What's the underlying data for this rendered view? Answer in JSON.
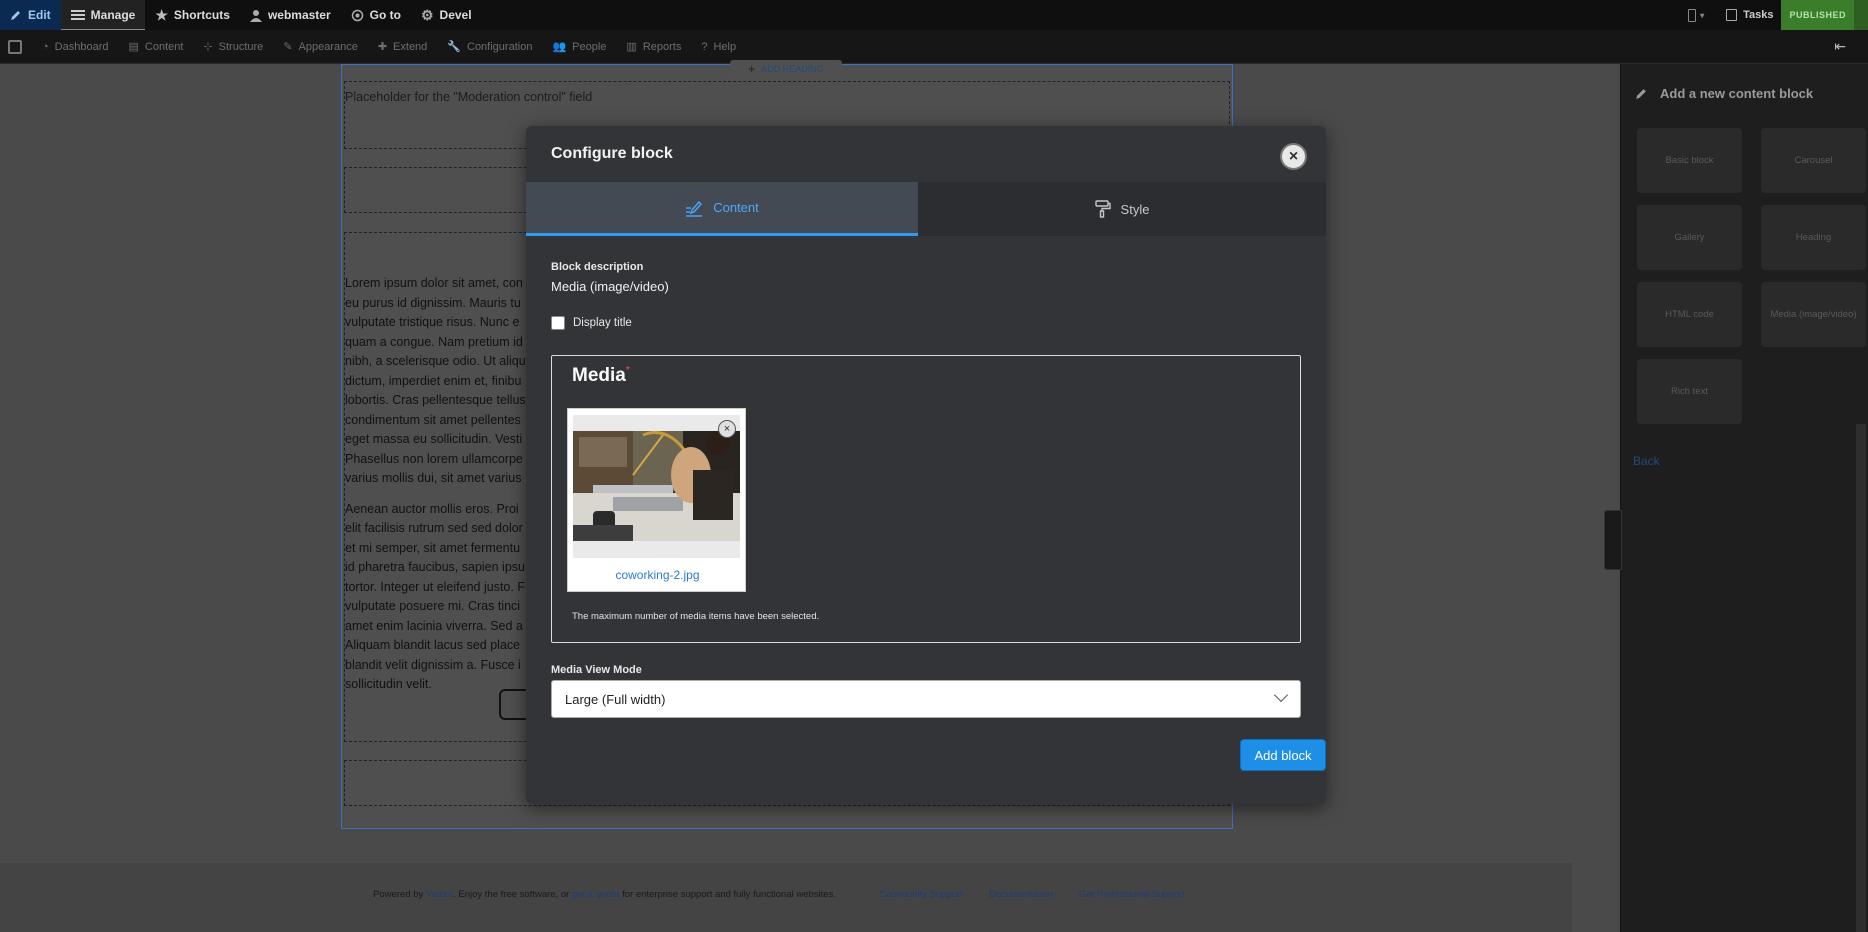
{
  "toolbar": {
    "edit": "Edit",
    "manage": "Manage",
    "shortcuts": "Shortcuts",
    "user": "webmaster",
    "goto": "Go to",
    "devel": "Devel",
    "tasks": "Tasks",
    "status": "PUBLISHED"
  },
  "admin_menu": {
    "items": [
      "Dashboard",
      "Content",
      "Structure",
      "Appearance",
      "Extend",
      "Configuration",
      "People",
      "Reports",
      "Help"
    ]
  },
  "page": {
    "add_heading": "ADD HEADING",
    "placeholder": "Placeholder for the \"Moderation control\" field",
    "lorem_lines": [
      "Lorem ipsum dolor sit amet, con",
      "eu purus id dignissim. Mauris tu",
      "vulputate tristique risus. Nunc e",
      "quam a congue. Nam pretium id",
      "nibh, a scelerisque odio. Ut aliqu",
      "dictum, imperdiet enim et, finibu",
      "lobortis. Cras pellentesque tellus",
      "condimentum sit amet pellentes",
      "eget massa eu sollicitudin. Vesti",
      "Phasellus non lorem ullamcorpe",
      "varius mollis dui, sit amet varius"
    ],
    "lorem_lines_2": [
      "Aenean auctor mollis eros. Proi",
      "elit facilisis rutrum sed sed dolor",
      "et mi semper, sit amet fermentu",
      "id pharetra faucibus, sapien ipsu",
      "tortor. Integer ut eleifend justo. F",
      "vulputate posuere mi. Cras tinci",
      "amet enim lacinia viverra. Sed a",
      "Aliquam blandit lacus sed place",
      "blandit velit dignissim a. Fusce i",
      "sollicitudin velit."
    ]
  },
  "footer": {
    "powered_prefix": "Powered by ",
    "varbase": "Varbot",
    "enjoy": ". Enjoy the free software, or ",
    "quote": "get a quote",
    "suffix": " for enterprise support and fully functional websites.",
    "links": [
      "Community Support",
      "Documentation",
      "Get Professional Support"
    ]
  },
  "sidebar": {
    "title": "Add a new content block",
    "blocks": [
      "Basic block",
      "Carousel",
      "Gallery",
      "Heading",
      "HTML code",
      "Media (image/video)",
      "Rich text"
    ],
    "back": "Back"
  },
  "modal": {
    "title": "Configure block",
    "close": "×",
    "tabs": [
      {
        "label": "Content",
        "icon": "content-edit-icon",
        "active": true
      },
      {
        "label": "Style",
        "icon": "paint-roller-icon",
        "active": false
      }
    ],
    "block_description_label": "Block description",
    "block_description_value": "Media (image/video)",
    "display_title_label": "Display title",
    "media_legend": "Media",
    "required_mark": "*",
    "media_item": {
      "name": "coworking-2.jpg",
      "remove": "×"
    },
    "media_help": "The maximum number of media items have been selected.",
    "view_mode_label": "Media View Mode",
    "view_mode_value": "Large (Full width)",
    "submit": "Add block"
  },
  "colors": {
    "accent": "#1d8fe6",
    "tab_active": "#4aa8ff",
    "published": "#3a7d2a"
  }
}
